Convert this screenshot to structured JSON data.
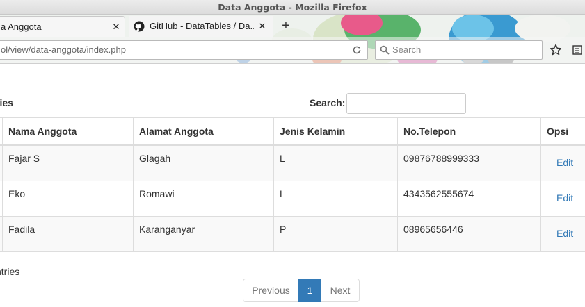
{
  "window": {
    "title": "Data Anggota - Mozilla Firefox"
  },
  "tabs": [
    {
      "label": "a Anggota"
    },
    {
      "label": "GitHub - DataTables / Da..."
    }
  ],
  "navbar": {
    "url": "ol/view/data-anggota/index.php",
    "search_placeholder": "Search"
  },
  "page": {
    "length_label": "ries",
    "search_label": "Search:",
    "search_value": "",
    "info_text": "ntries"
  },
  "table": {
    "columns": [
      "Nama Anggota",
      "Alamat Anggota",
      "Jenis Kelamin",
      "No.Telepon",
      "Opsi"
    ],
    "rows": [
      {
        "nama": "Fajar S",
        "alamat": "Glagah",
        "jk": "L",
        "telepon": "09876788999333",
        "opsi": "Edit"
      },
      {
        "nama": "Eko",
        "alamat": "Romawi",
        "jk": "L",
        "telepon": "4343562555674",
        "opsi": "Edit"
      },
      {
        "nama": "Fadila",
        "alamat": "Karanganyar",
        "jk": "P",
        "telepon": "08965656446",
        "opsi": "Edit"
      }
    ]
  },
  "pagination": {
    "previous": "Previous",
    "current": "1",
    "next": "Next"
  },
  "colors": {
    "link": "#337ab7",
    "active_page": "#337ab7",
    "row_stripe": "#f9f9f9",
    "border": "#dddddd"
  },
  "icons": [
    "tab-close-icon",
    "github-icon",
    "new-tab-icon",
    "reload-icon",
    "search-icon",
    "bookmark-star-icon",
    "reading-list-icon"
  ]
}
